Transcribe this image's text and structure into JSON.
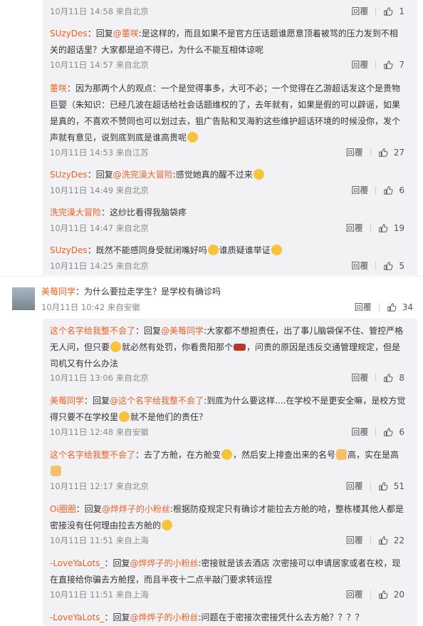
{
  "labels": {
    "reply": "回覆",
    "reply_prefix": "回复"
  },
  "comments": [
    {
      "meta": "10月11日 14:58 来自北京",
      "likes": "1"
    },
    {
      "user": "SUzyDes",
      "at": "@董咲",
      "text": ":是这样的，而且如果不是官方压话题谁愿意顶着被骂的压力发到不相关的超话里？大家都是迫不得已，为什么不能互相体谅呢",
      "meta": "10月11日 14:57 来自北京",
      "likes": "7"
    },
    {
      "user": "董咲",
      "text": "：因为那两个人的观点：一个是觉得事多，大可不必；一个觉得在乙游超话发这个是贵物巨婴（朱知识：已经几波在超话给社会话题维权的了，去年就有，如果是假的可以辟谣，如果是真的，不喜欢不赞同也可以划过去，狙广告贴和叉海豹这些维护超话环境的时候没你，发个声就有意见，说到底到底是谁高贵呢",
      "meta": "10月11日 14:53 来自江苏",
      "likes": "27"
    },
    {
      "user": "SUzyDes",
      "at": "@洗完澡大冒险",
      "text": ":感觉她真的醒不过来",
      "meta": "10月11日 14:49 来自北京",
      "likes": "6"
    },
    {
      "user": "洗完澡大冒险",
      "text": "：这纱比看得我脑袋疼",
      "meta": "10月11日 14:47 来自北京",
      "likes": "19"
    },
    {
      "user": "SUzyDes",
      "text": "：既然不能感同身受就闭嘴好吗",
      "text2": "谁质疑谁举证",
      "meta": "10月11日 14:25 来自北京",
      "likes": "5"
    }
  ],
  "top_comment": {
    "user": "美莓同学",
    "text": "：为什么要拉走学生？是学校有确诊吗",
    "meta": "10月11日 10:42 来自安徽",
    "likes": "34"
  },
  "replies": [
    {
      "user": "这个名字给我整不会了",
      "at": "@美莓同学",
      "text": ":大家都不想担责任，出了事儿脑袋保不住、管控严格无人问，但只要",
      "text2": "就必然有处罚，你看贵阳那个",
      "text3": "，问责的原因是违反交通管理规定，但是司机又有什么办法",
      "meta": "10月11日 13:06 来自北京",
      "likes": "8"
    },
    {
      "user": "美莓同学",
      "at": "@这个名字给我整不会了",
      "text": ":到底为什么要这样....在学校不是更安全嘛，是校方觉得只要不在学校里",
      "text2": "就不是他们的责任？",
      "meta": "10月11日 12:48 来自安徽",
      "likes": "6"
    },
    {
      "user": "这个名字给我整不会了",
      "text": "：去了方舱，在方舱变",
      "text2": "，然后安上排查出来的名号",
      "text3": "高，实在是高",
      "meta": "10月11日 12:17 来自北京",
      "likes": "51"
    },
    {
      "user": "Oi圈圈",
      "at": "@烨烨子的小粉丝",
      "text": ":根据防疫规定只有确诊才能拉去方舱的哈，整栋楼其他人都是密接没有任何理由拉去方舱的",
      "meta": "10月11日 11:51 来自上海",
      "likes": "22"
    },
    {
      "user": "-LoveYaLots_",
      "at": "@烨烨子的小粉丝",
      "text": ":密接就是该去酒店 次密接可以申请居家或者在校，现在直接给你骗去方舱捏，而且半夜十二点半敲门要求转运捏",
      "meta": "10月11日 11:51 来自上海",
      "likes": "20"
    },
    {
      "user": "-LoveYaLots_",
      "at": "@烨烨子的小粉丝",
      "text": ":问题在于密接次密接凭什么去方舱？？？？"
    }
  ]
}
